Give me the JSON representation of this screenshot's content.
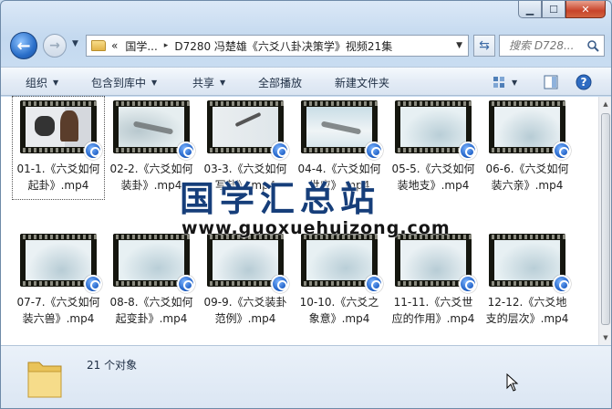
{
  "window": {
    "caption": {
      "minimize": "▁",
      "maximize": "☐",
      "close": "✕"
    }
  },
  "nav": {
    "back_icon": "arrow-left-icon",
    "forward_icon": "arrow-right-icon",
    "breadcrumb": {
      "prefix": "«",
      "segment1": "国学...",
      "separator": "▸",
      "segment2": "D7280 冯楚雄《六爻八卦决策学》视频21集"
    },
    "search": {
      "placeholder": "搜索 D728..."
    }
  },
  "toolbar": {
    "organize": "组织",
    "include_in_library": "包含到库中",
    "share": "共享",
    "play_all": "全部播放",
    "new_folder": "新建文件夹"
  },
  "files": [
    {
      "line1": "01-1.《六爻如何",
      "line2": "起卦》.mp4"
    },
    {
      "line1": "02-2.《六爻如何",
      "line2": "装卦》.mp4"
    },
    {
      "line1": "03-3.《六爻如何",
      "line2": "写卦》.mp4"
    },
    {
      "line1": "04-4.《六爻如何",
      "line2": "世应》.mp4"
    },
    {
      "line1": "05-5.《六爻如何",
      "line2": "装地支》.mp4"
    },
    {
      "line1": "06-6.《六爻如何",
      "line2": "装六亲》.mp4"
    },
    {
      "line1": "07-7.《六爻如何",
      "line2": "装六兽》.mp4"
    },
    {
      "line1": "08-8.《六爻如何",
      "line2": "起变卦》.mp4"
    },
    {
      "line1": "09-9.《六爻装卦",
      "line2": "范例》.mp4"
    },
    {
      "line1": "10-10.《六爻之",
      "line2": "象意》.mp4"
    },
    {
      "line1": "11-11.《六爻世",
      "line2": "应的作用》.mp4"
    },
    {
      "line1": "12-12.《六爻地",
      "line2": "支的层次》.mp4"
    }
  ],
  "watermark": {
    "cn": "国学汇总站",
    "url": "www.guoxuehuizong.com"
  },
  "details": {
    "count_text": "21 个对象"
  },
  "colors": {
    "accent": "#2a6fc9",
    "close": "#c8442a"
  }
}
